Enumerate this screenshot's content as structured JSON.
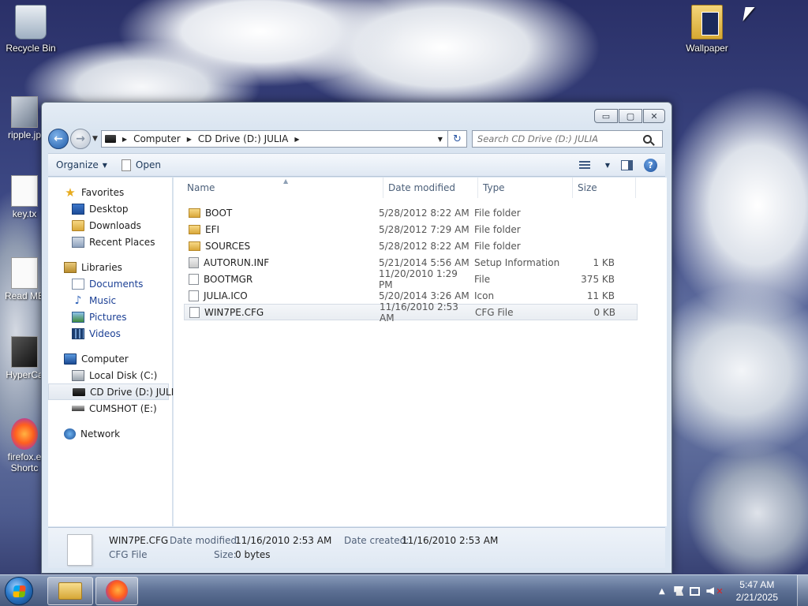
{
  "desktop": {
    "icons_right": [
      {
        "label": "Recycle Bin"
      },
      {
        "label": "Wallpaper"
      }
    ],
    "icons_left": [
      {
        "label": "ripple.jp"
      },
      {
        "label": "key.tx"
      },
      {
        "label": "Read ME"
      },
      {
        "label": "HyperCa"
      },
      {
        "label": "firefox.e"
      },
      {
        "label": "Shortc"
      }
    ]
  },
  "window": {
    "captions": {
      "minimize": "▭",
      "maximize": "▢",
      "close": "✕"
    },
    "address": {
      "crumbs": [
        "Computer",
        "CD Drive (D:) JULIA"
      ]
    },
    "search": {
      "placeholder": "Search CD Drive (D:) JULIA"
    },
    "toolbar": {
      "organize": "Organize",
      "open": "Open",
      "help": "?"
    },
    "nav": {
      "favorites": "Favorites",
      "favorites_items": [
        "Desktop",
        "Downloads",
        "Recent Places"
      ],
      "libraries": "Libraries",
      "libraries_items": [
        "Documents",
        "Music",
        "Pictures",
        "Videos"
      ],
      "computer": "Computer",
      "computer_items": [
        "Local Disk (C:)",
        "CD Drive (D:) JULIA",
        "CUMSHOT (E:)"
      ],
      "network": "Network"
    },
    "columns": {
      "name": "Name",
      "date": "Date modified",
      "type": "Type",
      "size": "Size"
    },
    "files": [
      {
        "name": "BOOT",
        "date": "5/28/2012 8:22 AM",
        "type": "File folder",
        "size": ""
      },
      {
        "name": "EFI",
        "date": "5/28/2012 7:29 AM",
        "type": "File folder",
        "size": ""
      },
      {
        "name": "SOURCES",
        "date": "5/28/2012 8:22 AM",
        "type": "File folder",
        "size": ""
      },
      {
        "name": "AUTORUN.INF",
        "date": "5/21/2014 5:56 AM",
        "type": "Setup Information",
        "size": "1 KB"
      },
      {
        "name": "BOOTMGR",
        "date": "11/20/2010 1:29 PM",
        "type": "File",
        "size": "375 KB"
      },
      {
        "name": "JULIA.ICO",
        "date": "5/20/2014 3:26 AM",
        "type": "Icon",
        "size": "11 KB"
      },
      {
        "name": "WIN7PE.CFG",
        "date": "11/16/2010 2:53 AM",
        "type": "CFG File",
        "size": "0 KB"
      }
    ],
    "details": {
      "name": "WIN7PE.CFG",
      "type": "CFG File",
      "modified_label": "Date modified:",
      "modified_value": "11/16/2010 2:53 AM",
      "size_label": "Size:",
      "size_value": "0 bytes",
      "created_label": "Date created:",
      "created_value": "11/16/2010 2:53 AM"
    }
  },
  "taskbar": {
    "clock_time": "5:47 AM",
    "clock_date": "2/21/2025",
    "tray_expand": "▲"
  },
  "icons": [
    "recycle-bin-icon",
    "folder-icon",
    "drive-icon",
    "star-icon",
    "search-icon",
    "help-icon",
    "firefox-icon",
    "windows-logo-icon"
  ]
}
